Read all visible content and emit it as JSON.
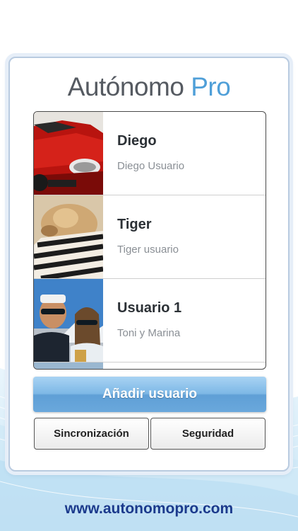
{
  "app": {
    "title_part1": "Autónomo ",
    "title_part2": "Pro"
  },
  "users": [
    {
      "name": "Diego",
      "subtitle": "Diego Usuario",
      "photo": "red-car-photo"
    },
    {
      "name": "Tiger",
      "subtitle": "Tiger usuario",
      "photo": "sleeping-cat-photo"
    },
    {
      "name": "Usuario 1",
      "subtitle": "Toni y Marina",
      "photo": "couple-selfie-photo"
    }
  ],
  "buttons": {
    "add_user": "Añadir usuario",
    "sync": "Sincronización",
    "security": "Seguridad"
  },
  "footer": {
    "url": "www.autonomopro.com"
  },
  "colors": {
    "accent": "#4f9fd8",
    "url_text": "#1b3a8c",
    "wave_light": "#d6ecf8",
    "wave_mid": "#bfe0f3"
  }
}
